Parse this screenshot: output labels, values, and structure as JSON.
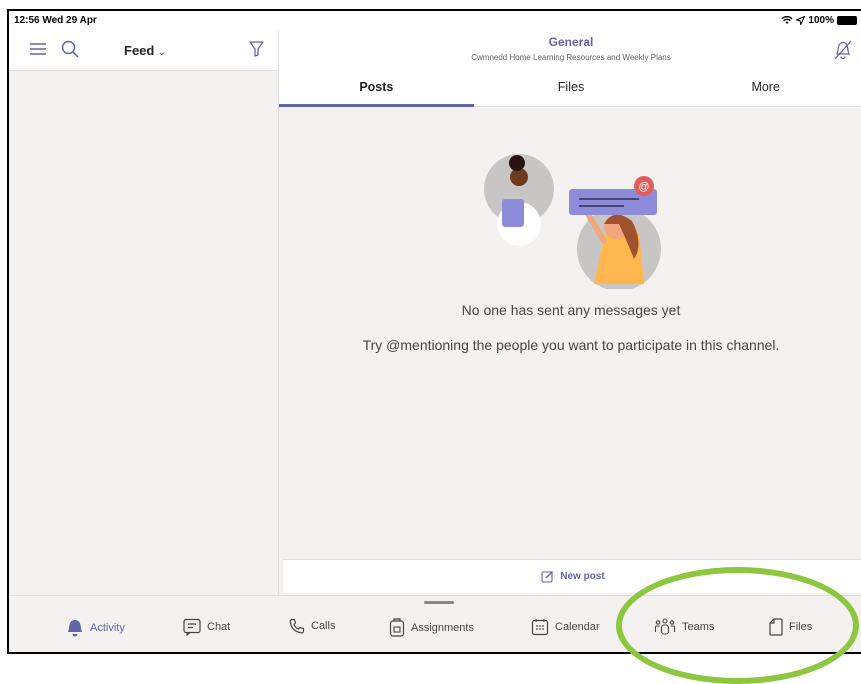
{
  "status_bar": {
    "time": "12:56  Wed 29 Apr",
    "battery": "100%"
  },
  "left_pane": {
    "feed_label": "Feed",
    "feed_chevron": "⌄"
  },
  "channel": {
    "title": "General",
    "subtitle": "Cwmnedd Home Learning Resources and Weekly Plans"
  },
  "tabs": [
    {
      "label": "Posts",
      "active": true
    },
    {
      "label": "Files",
      "active": false
    },
    {
      "label": "More",
      "active": false
    }
  ],
  "empty_state": {
    "message": "No one has sent any messages yet",
    "hint": "Try @mentioning the people you want to participate in this channel."
  },
  "new_post": {
    "label": "New post"
  },
  "bottom_nav": [
    {
      "label": "Activity",
      "icon": "bell-icon",
      "active": true
    },
    {
      "label": "Chat",
      "icon": "chat-icon",
      "active": false
    },
    {
      "label": "Calls",
      "icon": "phone-icon",
      "active": false
    },
    {
      "label": "Assignments",
      "icon": "assignments-icon",
      "active": false
    },
    {
      "label": "Calendar",
      "icon": "calendar-icon",
      "active": false
    },
    {
      "label": "Teams",
      "icon": "teams-icon",
      "active": false
    },
    {
      "label": "Files",
      "icon": "file-icon",
      "active": false
    }
  ],
  "colors": {
    "accent": "#6264a7",
    "highlight": "#8dc63f",
    "background": "#f3f2f1"
  }
}
